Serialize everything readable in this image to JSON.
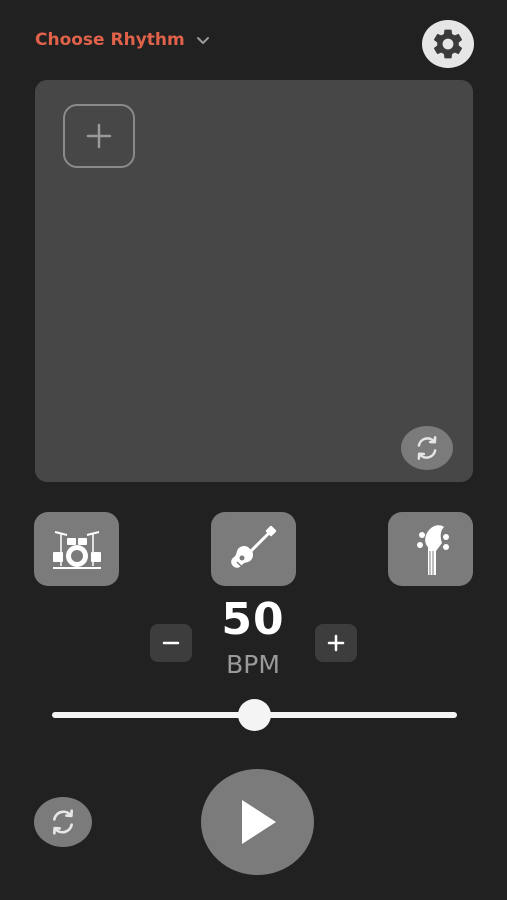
{
  "header": {
    "title": "Choose Rhythm",
    "dropdown_icon": "chevron-down-icon"
  },
  "settings": {
    "icon": "gear-icon"
  },
  "pad": {
    "add_icon": "plus-icon",
    "refresh_icon": "refresh-icon"
  },
  "instruments": [
    {
      "icon": "drum-kit-icon"
    },
    {
      "icon": "guitar-icon"
    },
    {
      "icon": "bass-headstock-icon"
    }
  ],
  "tempo": {
    "value": "50",
    "unit": "BPM",
    "decrement_label": "−",
    "increment_label": "+",
    "slider_fraction": 0.5
  },
  "controls": {
    "reset_icon": "refresh-icon",
    "play_icon": "play-icon"
  },
  "colors": {
    "background": "#212121",
    "accent": "#e0624a",
    "pad": "#474747",
    "button": "#7b7b7b"
  }
}
